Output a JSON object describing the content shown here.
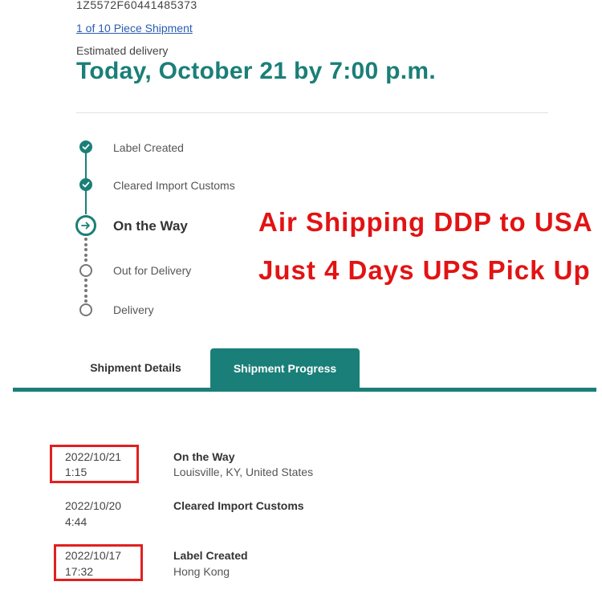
{
  "header": {
    "tracking_number": "1Z5572F60441485373",
    "piece_link": "1 of 10 Piece Shipment",
    "estimated_label": "Estimated delivery",
    "estimated_date": "Today, October 21 by 7:00 p.m."
  },
  "progress": {
    "steps": [
      {
        "label": "Label Created",
        "state": "done"
      },
      {
        "label": "Cleared Import Customs",
        "state": "done"
      },
      {
        "label": "On the Way",
        "state": "current"
      },
      {
        "label": "Out for Delivery",
        "state": "pending"
      },
      {
        "label": "Delivery",
        "state": "pending"
      }
    ]
  },
  "promo": {
    "line1": "Air Shipping DDP to USA",
    "line2": "Just 4 Days UPS Pick Up",
    "color": "#e21313"
  },
  "tabs": [
    {
      "label": "Shipment Details",
      "active": false
    },
    {
      "label": "Shipment Progress",
      "active": true
    }
  ],
  "activity": [
    {
      "date": "2022/10/21",
      "time": "1:15",
      "status": "On the Way",
      "location": "Louisville, KY, United States",
      "highlighted": true
    },
    {
      "date": "2022/10/20",
      "time": "4:44",
      "status": "Cleared Import Customs",
      "location": "",
      "highlighted": false
    },
    {
      "date": "2022/10/17",
      "time": "17:32",
      "status": "Label Created",
      "location": "Hong Kong",
      "highlighted": true
    }
  ],
  "colors": {
    "accent": "#1a7f78",
    "link": "#2a5db0",
    "highlight": "#e02020"
  }
}
